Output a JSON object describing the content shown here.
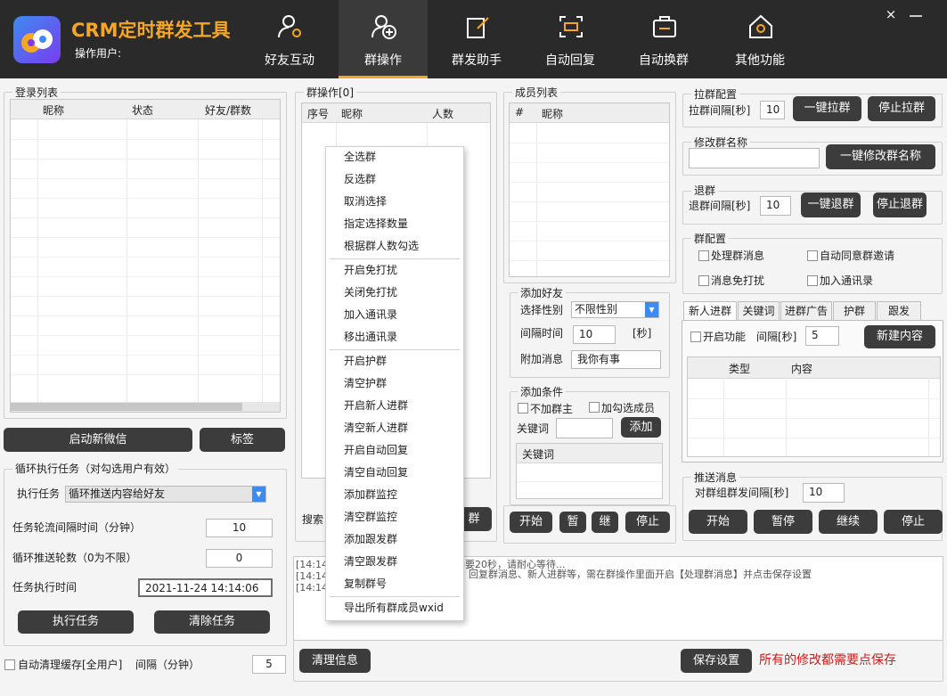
{
  "header": {
    "app_title": "CRM定时群发工具",
    "operator_label": "操作用户:",
    "close_glyph": "×",
    "nav": [
      {
        "label": "好友互动",
        "icon": "user-gear-icon"
      },
      {
        "label": "群操作",
        "icon": "group-add-icon",
        "active": true
      },
      {
        "label": "群发助手",
        "icon": "edit-doc-icon"
      },
      {
        "label": "自动回复",
        "icon": "auto-reply-icon"
      },
      {
        "label": "自动换群",
        "icon": "switch-group-icon"
      },
      {
        "label": "其他功能",
        "icon": "home-gear-icon"
      }
    ],
    "accent_color": "#f5a623",
    "bar_color": "#2a2a2a"
  },
  "login_list": {
    "title": "登录列表",
    "columns": [
      "昵称",
      "状态",
      "好友/群数"
    ],
    "start_button": "启动新微信",
    "tag_button": "标签"
  },
  "loop_task": {
    "title": "循环执行任务（对勾选用户有效）",
    "task_label": "执行任务",
    "task_value": "循环推送内容给好友",
    "interval_label": "任务轮流间隔时间（分钟）",
    "interval_value": "10",
    "rounds_label": "循环推送轮数（0为不限）",
    "rounds_value": "0",
    "time_label": "任务执行时间",
    "time_value": "2021-11-24 14:14:06",
    "execute_button": "执行任务",
    "clear_button": "清除任务"
  },
  "auto_clean": {
    "label": "自动清理缓存[全用户]",
    "interval_label": "间隔（分钟）",
    "interval_value": "5"
  },
  "group_ops": {
    "title": "群操作[0]",
    "columns": [
      "序号",
      "昵称",
      "人数"
    ],
    "search_label": "搜索",
    "search_button_fragment": "群"
  },
  "context_menu": {
    "items": [
      "全选群",
      "反选群",
      "取消选择",
      "指定选择数量",
      "根据群人数勾选",
      "开启免打扰",
      "关闭免打扰",
      "加入通讯录",
      "移出通讯录",
      "开启护群",
      "清空护群",
      "开启新人进群",
      "清空新人进群",
      "开启自动回复",
      "清空自动回复",
      "添加群监控",
      "清空群监控",
      "添加跟发群",
      "清空跟发群",
      "复制群号",
      "导出所有群成员wxid"
    ]
  },
  "member_list": {
    "title": "成员列表",
    "columns": [
      "#",
      "昵称"
    ]
  },
  "add_friend": {
    "title": "添加好友",
    "gender_label": "选择性别",
    "gender_value": "不限性别",
    "interval_label": "间隔时间",
    "interval_value": "10",
    "interval_unit": "[秒]",
    "message_label": "附加消息",
    "message_value": "我你有事"
  },
  "add_condition": {
    "title": "添加条件",
    "no_owner": "不加群主",
    "tick_selected": "加勾选成员",
    "keyword_label": "关键词",
    "add_button": "添加",
    "keyword_column": "关键词"
  },
  "member_actions": {
    "start": "开始",
    "pause": "暂",
    "resume": "继",
    "stop": "停止"
  },
  "pull_group": {
    "title": "拉群配置",
    "interval_label": "拉群间隔[秒]",
    "interval_value": "10",
    "one_key_button": "一键拉群",
    "stop_button": "停止拉群"
  },
  "rename_group": {
    "title": "修改群名称",
    "button": "一键修改群名称"
  },
  "exit_group": {
    "title": "退群",
    "interval_label": "退群间隔[秒]",
    "interval_value": "10",
    "one_key_button": "一键退群",
    "stop_button": "停止退群"
  },
  "group_config": {
    "title": "群配置",
    "options": [
      "处理群消息",
      "自动同意群邀请",
      "消息免打扰",
      "加入通讯录"
    ]
  },
  "tabs": {
    "items": [
      "新人进群",
      "关键词",
      "进群广告",
      "护群",
      "跟发"
    ],
    "enable_label": "开启功能",
    "interval_label": "间隔[秒]",
    "interval_value": "5",
    "new_content_button": "新建内容",
    "columns": [
      "类型",
      "内容"
    ]
  },
  "push_message": {
    "title": "推送消息",
    "interval_label": "对群组群发间隔[秒]",
    "interval_value": "10",
    "start": "开始",
    "pause": "暂停",
    "resume": "继续",
    "stop": "停止"
  },
  "log": {
    "lines": [
      "[14:14",
      "[14:14",
      "[14:14"
    ],
    "line1_tail": "要20秒，请耐心等待...",
    "line2_tail": "回复群消息、新人进群等，需在群操作里面开启【处理群消息】并点击保存设置"
  },
  "footer": {
    "clear_button": "清理信息",
    "save_button": "保存设置",
    "save_hint": "所有的修改都需要点保存",
    "hint_color": "#d11a1a"
  }
}
